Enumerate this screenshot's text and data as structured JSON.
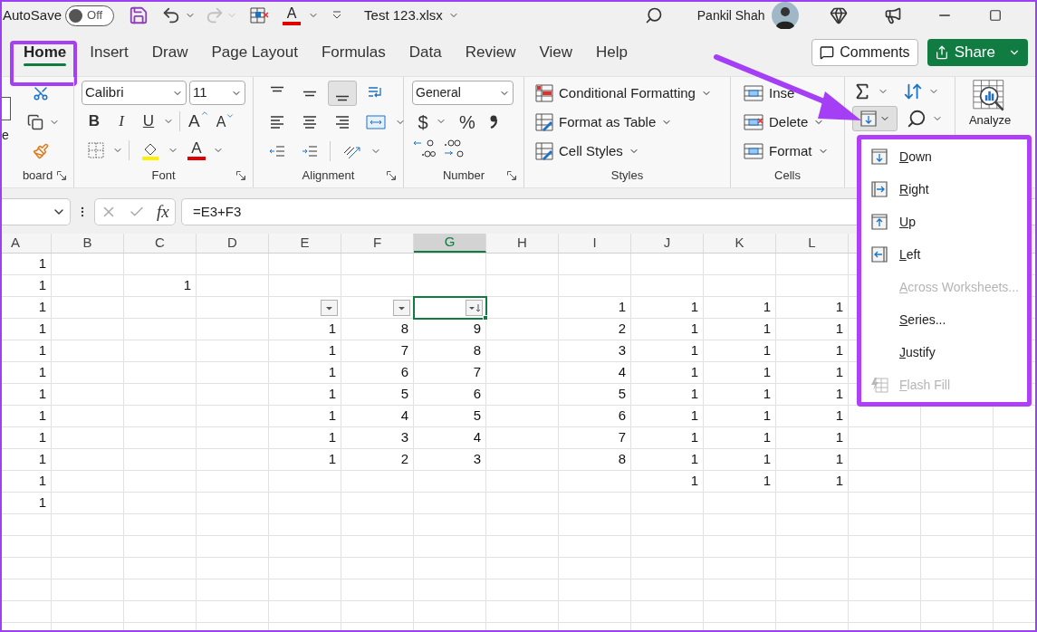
{
  "title_bar": {
    "autosave_label": "AutoSave",
    "autosave": {
      "on": false,
      "state_label": "Off"
    },
    "font_color_letter": "A",
    "file_name": "Test 123.xlsx",
    "user_name": "Pankil Shah"
  },
  "tabs": [
    {
      "label": "Home",
      "selected": true
    },
    {
      "label": "Insert",
      "selected": false
    },
    {
      "label": "Draw",
      "selected": false
    },
    {
      "label": "Page Layout",
      "selected": false
    },
    {
      "label": "Formulas",
      "selected": false
    },
    {
      "label": "Data",
      "selected": false
    },
    {
      "label": "Review",
      "selected": false
    },
    {
      "label": "View",
      "selected": false
    },
    {
      "label": "Help",
      "selected": false
    }
  ],
  "comments_button": "Comments",
  "share_button": "Share",
  "ribbon": {
    "clipboard": {
      "paste_label": "e",
      "label": "board"
    },
    "font": {
      "name": "Calibri",
      "size": "11",
      "format_buttons": [
        "B",
        "I",
        "U"
      ],
      "grow_letter": "A",
      "shrink_letter": "A",
      "font_color_letter": "A",
      "label": "Font"
    },
    "alignment": {
      "vertical_buttons": [
        {
          "pressed": false
        },
        {
          "pressed": false
        },
        {
          "pressed": true
        }
      ],
      "label": "Alignment"
    },
    "number": {
      "format": "General",
      "currency_symbol": "$",
      "percent_symbol": "%",
      "label": "Number"
    },
    "styles": {
      "buttons": [
        "Conditional Formatting",
        "Format as Table",
        "Cell Styles"
      ],
      "label": "Styles"
    },
    "cells": {
      "buttons": [
        "Inse",
        "Delete",
        "Format"
      ],
      "label": "Cells"
    },
    "editing": {
      "fill_pressed": true
    },
    "analyze": {
      "label": "Analyze"
    }
  },
  "formula_bar": {
    "fx": "fx",
    "formula": "=E3+F3"
  },
  "columns": [
    {
      "label": "A",
      "selected": false
    },
    {
      "label": "B",
      "selected": false
    },
    {
      "label": "C",
      "selected": false
    },
    {
      "label": "D",
      "selected": false
    },
    {
      "label": "E",
      "selected": false
    },
    {
      "label": "F",
      "selected": false
    },
    {
      "label": "G",
      "selected": true
    },
    {
      "label": "H",
      "selected": false
    },
    {
      "label": "I",
      "selected": false
    },
    {
      "label": "J",
      "selected": false
    },
    {
      "label": "K",
      "selected": false
    },
    {
      "label": "L",
      "selected": false
    }
  ],
  "rows": [
    {
      "selected": false,
      "cells": [
        "1"
      ]
    },
    {
      "selected": false,
      "cells": [
        "1",
        null,
        "1"
      ]
    },
    {
      "selected": true,
      "cells": [
        "1",
        null,
        null,
        null,
        {
          "kind": "filter",
          "sorted": false
        },
        {
          "kind": "filter",
          "sorted": false
        },
        {
          "kind": "filter",
          "sorted": true
        },
        null,
        "1",
        "1",
        "1",
        "1"
      ]
    },
    {
      "selected": false,
      "cells": [
        "1",
        null,
        null,
        null,
        "1",
        "8",
        "9",
        null,
        "2",
        "1",
        "1",
        "1"
      ]
    },
    {
      "selected": false,
      "cells": [
        "1",
        null,
        null,
        null,
        "1",
        "7",
        "8",
        null,
        "3",
        "1",
        "1",
        "1"
      ]
    },
    {
      "selected": false,
      "cells": [
        "1",
        null,
        null,
        null,
        "1",
        "6",
        "7",
        null,
        "4",
        "1",
        "1",
        "1"
      ]
    },
    {
      "selected": false,
      "cells": [
        "1",
        null,
        null,
        null,
        "1",
        "5",
        "6",
        null,
        "5",
        "1",
        "1",
        "1"
      ]
    },
    {
      "selected": false,
      "cells": [
        "1",
        null,
        null,
        null,
        "1",
        "4",
        "5",
        null,
        "6",
        "1",
        "1",
        "1"
      ]
    },
    {
      "selected": false,
      "cells": [
        "1",
        null,
        null,
        null,
        "1",
        "3",
        "4",
        null,
        "7",
        "1",
        "1",
        "1"
      ]
    },
    {
      "selected": false,
      "cells": [
        "1",
        null,
        null,
        null,
        "1",
        "2",
        "3",
        null,
        "8",
        "1",
        "1",
        "1"
      ]
    },
    {
      "selected": false,
      "cells": [
        "1",
        null,
        null,
        null,
        null,
        null,
        null,
        null,
        null,
        "1",
        "1",
        "1"
      ]
    },
    {
      "selected": false,
      "cells": [
        "1"
      ]
    }
  ],
  "fill_menu": {
    "items": [
      {
        "label": "Down",
        "kind": "down",
        "disabled": false
      },
      {
        "label": "Right",
        "kind": "right",
        "disabled": false
      },
      {
        "label": "Up",
        "kind": "up",
        "disabled": false
      },
      {
        "label": "Left",
        "kind": "left",
        "disabled": false
      },
      {
        "label": "Across Worksheets...",
        "kind": "plain",
        "disabled": true
      },
      {
        "label": "Series...",
        "kind": "plain",
        "disabled": false
      },
      {
        "label": "Justify",
        "kind": "plain",
        "disabled": false
      },
      {
        "label": "Flash Fill",
        "kind": "flash",
        "disabled": true
      }
    ]
  }
}
